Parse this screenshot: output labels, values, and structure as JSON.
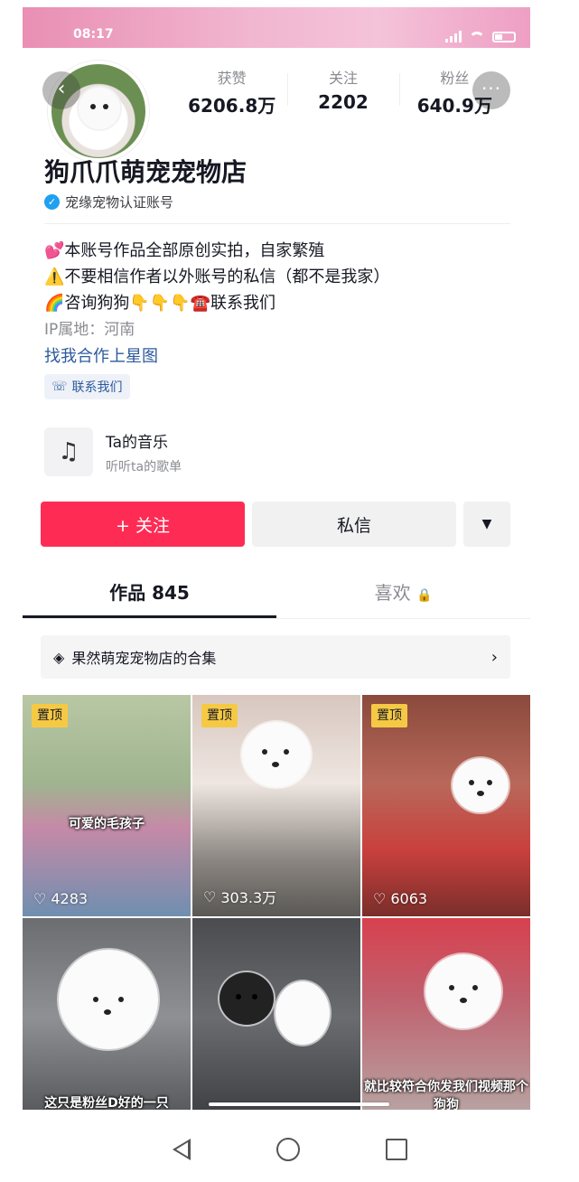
{
  "status_bar": {
    "time": "08:17"
  },
  "profile": {
    "name": "狗爪爪萌宠宠物店",
    "verification": "宠缘宠物认证账号",
    "stats": [
      {
        "label": "获赞",
        "value": "6206.8万"
      },
      {
        "label": "关注",
        "value": "2202"
      },
      {
        "label": "粉丝",
        "value": "640.9万"
      }
    ],
    "bio": [
      "💕本账号作品全部原创实拍，自家繁殖",
      "⚠️不要相信作者以外账号的私信（都不是我家）",
      "🌈咨询狗狗👇👇👇☎️联系我们"
    ],
    "ip_location": "IP属地：河南",
    "star_link": "找我合作上星图",
    "contact_chip": "联系我们"
  },
  "music": {
    "title": "Ta的音乐",
    "subtitle": "听听ta的歌单"
  },
  "actions": {
    "follow": "+ 关注",
    "message": "私信"
  },
  "tabs": {
    "works": "作品 845",
    "likes": "喜欢"
  },
  "collection": {
    "label": "果然萌宠宠物店的合集"
  },
  "videos": [
    {
      "pinned": "置顶",
      "likes": "4283",
      "caption": "可爱的毛孩子"
    },
    {
      "pinned": "置顶",
      "likes": "303.3万",
      "caption": ""
    },
    {
      "pinned": "置顶",
      "likes": "6063",
      "caption": ""
    },
    {
      "pinned": "",
      "likes": "",
      "caption": "这只是粉丝D好的一只"
    },
    {
      "pinned": "",
      "likes": "",
      "caption": ""
    },
    {
      "pinned": "",
      "likes": "",
      "caption": "就比较符合你发我们视频那个狗狗"
    }
  ],
  "colors": {
    "follow_button": "#fe2c55",
    "pin_badge": "#f6c945",
    "link": "#2c5a9c"
  }
}
